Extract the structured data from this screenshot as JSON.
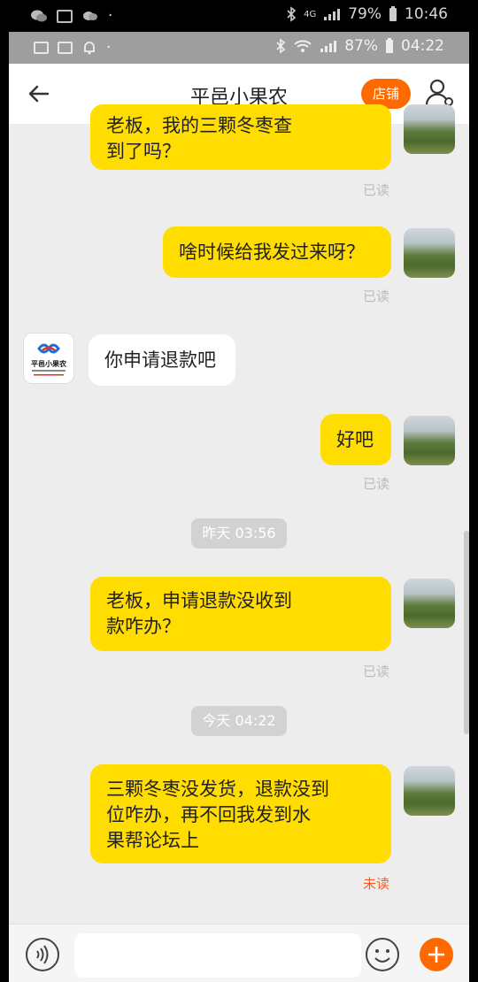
{
  "outer_status": {
    "battery": "79%",
    "time": "10:46",
    "network": "4G"
  },
  "inner_status": {
    "battery": "87%",
    "time": "04:22"
  },
  "nav": {
    "title": "平邑小果农",
    "shop_label": "店铺"
  },
  "shop_avatar_text": "平邑小果农",
  "messages": [
    {
      "line1": "老板，我的三颗冬枣查",
      "line2": "到了吗？",
      "status": "已读"
    },
    {
      "text": "啥时候给我发过来呀？",
      "status": "已读"
    },
    {
      "text": "你申请退款吧"
    },
    {
      "text": "好吧",
      "status": "已读"
    },
    {
      "line1": "老板，申请退款没收到",
      "line2": "款咋办？",
      "status": "已读"
    },
    {
      "line1": "三颗冬枣没发货，退款没到",
      "line2": "位咋办，再不回我发到水",
      "line3": "果帮论坛上",
      "status": "未读"
    }
  ],
  "timestamps": [
    "昨天  03:56",
    "今天  04:22"
  ],
  "icons": [
    "back-arrow-icon",
    "user-settings-icon",
    "voice-icon",
    "emoji-icon",
    "plus-icon"
  ],
  "colors": {
    "accent": "#ff6a00",
    "bubble": "#ffdd00",
    "unread": "#ff5a1f"
  }
}
